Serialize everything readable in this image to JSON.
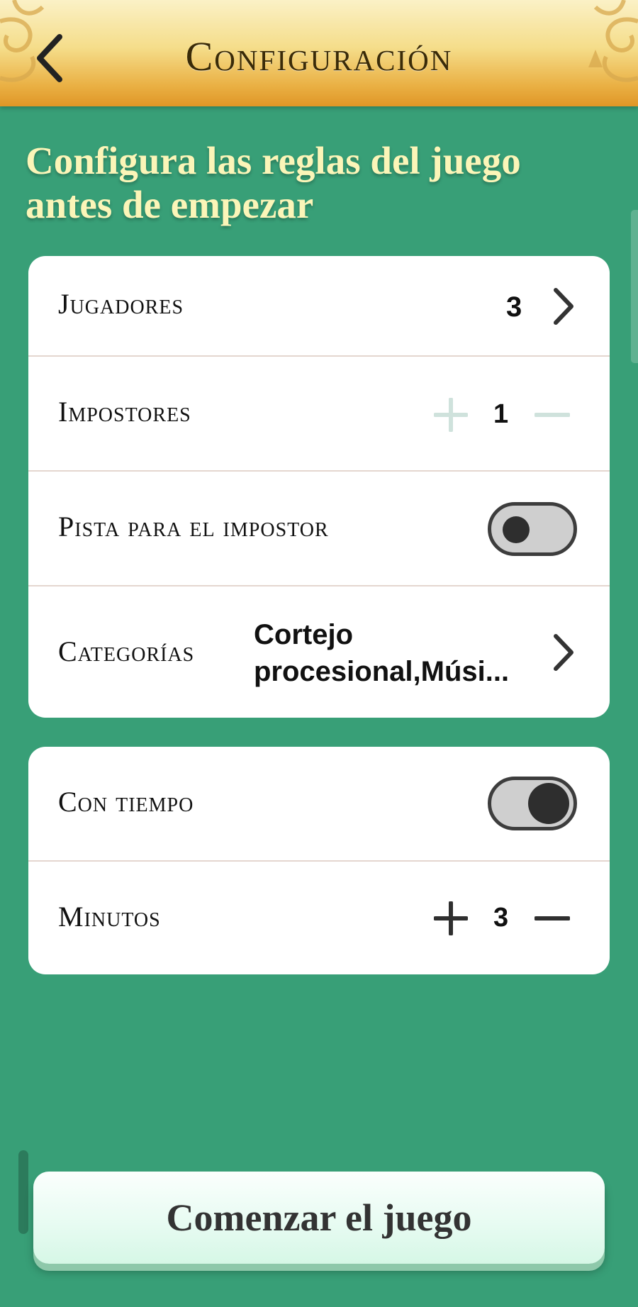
{
  "header": {
    "title": "Configuración",
    "back_icon": "chevron-left-icon",
    "colors": {
      "top": "#fbf1c6",
      "bottom": "#df9626"
    }
  },
  "intro": "Configura las reglas del juego antes de empezar",
  "settings": {
    "players": {
      "label": "Jugadores",
      "value": "3"
    },
    "impostors": {
      "label": "Impostores",
      "value": "1",
      "plus_enabled": false,
      "minus_enabled": false
    },
    "impostor_hint": {
      "label": "Pista para el impostor",
      "on": false
    },
    "categories": {
      "label": "Categorías",
      "value_line1": "Cortejo",
      "value_line2": "procesional,Músi..."
    }
  },
  "timer": {
    "with_time": {
      "label": "Con tiempo",
      "on": true
    },
    "minutes": {
      "label": "Minutos",
      "value": "3"
    }
  },
  "start_button": {
    "label": "Comenzar el juego"
  },
  "colors": {
    "background": "#389f77",
    "intro_text": "#fbf5b8",
    "card": "#ffffff"
  }
}
